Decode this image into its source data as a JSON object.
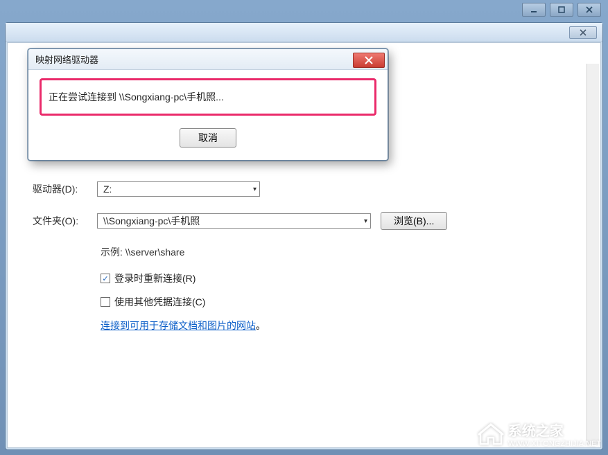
{
  "outer_window": {
    "min_tooltip": "最小化",
    "max_tooltip": "最大化",
    "close_tooltip": "关闭"
  },
  "inner_window": {
    "close_label": "X"
  },
  "form": {
    "drive_label": "驱动器(D):",
    "drive_value": "Z:",
    "folder_label": "文件夹(O):",
    "folder_value": "\\\\Songxiang-pc\\手机照",
    "browse_label": "浏览(B)...",
    "example_label": "示例: \\\\server\\share",
    "reconnect_label": "登录时重新连接(R)",
    "reconnect_checked": true,
    "other_creds_label": "使用其他凭据连接(C)",
    "other_creds_checked": false,
    "link_label": "连接到可用于存储文档和图片的网站",
    "link_suffix": "。"
  },
  "progress_dialog": {
    "title": "映射网络驱动器",
    "status_text": "正在尝试连接到 \\\\Songxiang-pc\\手机照...",
    "cancel_label": "取消"
  },
  "watermark": {
    "text": "系统之家",
    "url": "WWW.XITONGZHIJIA.NET"
  }
}
